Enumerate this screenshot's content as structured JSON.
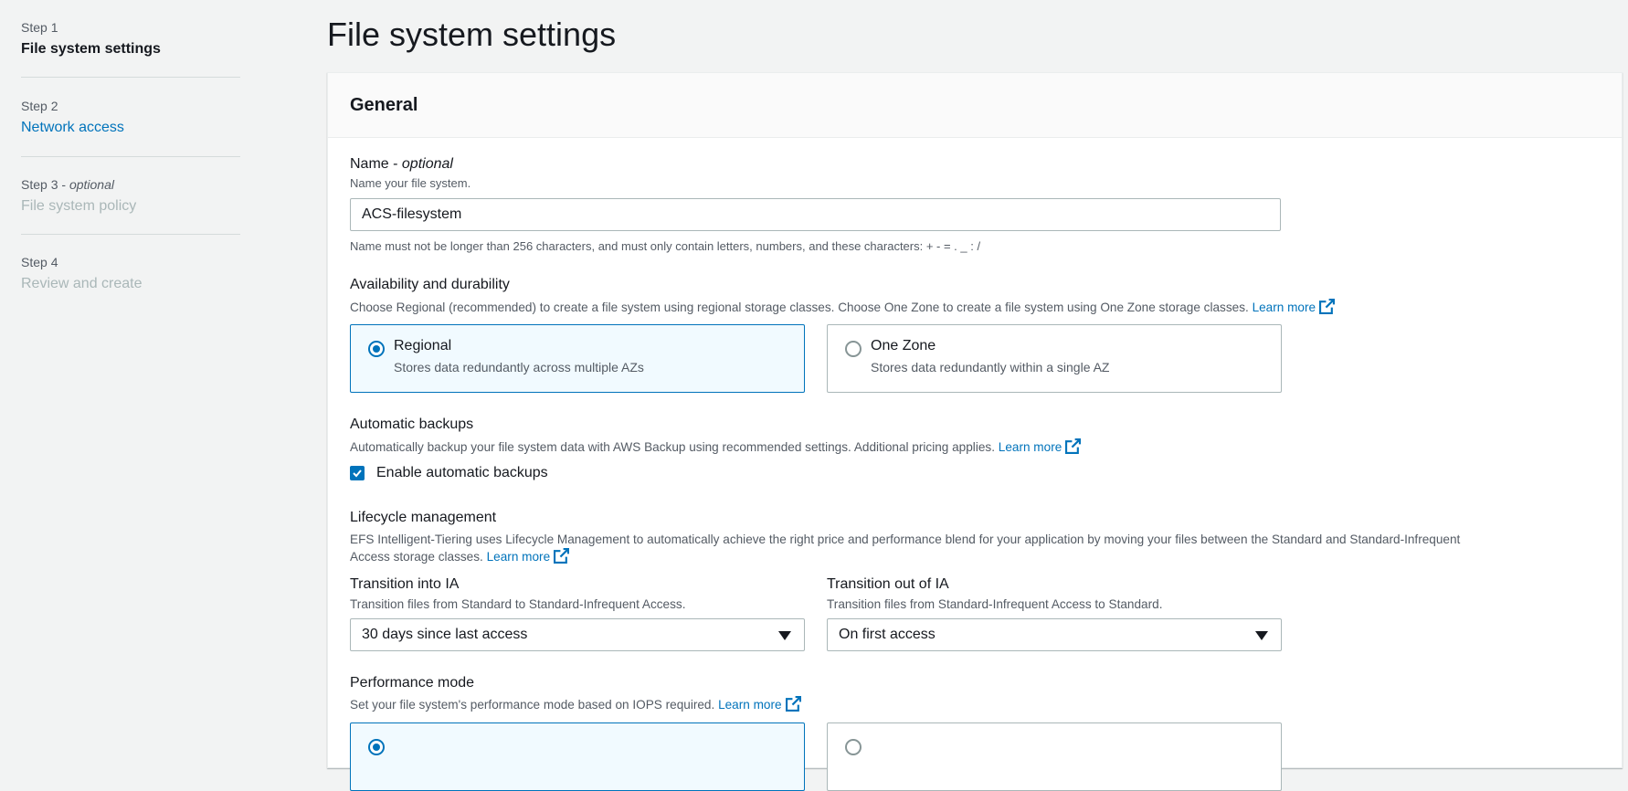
{
  "sidebar": {
    "steps": [
      {
        "num": "Step 1",
        "title": "File system settings"
      },
      {
        "num": "Step 2",
        "title": "Network access"
      },
      {
        "num": "Step 3",
        "num_suffix": "optional",
        "title": "File system policy"
      },
      {
        "num": "Step 4",
        "title": "Review and create"
      }
    ]
  },
  "page": {
    "title": "File system settings"
  },
  "general": {
    "header": "General",
    "name": {
      "label": "Name",
      "label_suffix": "optional",
      "description": "Name your file system.",
      "value": "ACS-filesystem",
      "constraint": "Name must not be longer than 256 characters, and must only contain letters, numbers, and these characters: + - = . _ : /"
    },
    "availability": {
      "label": "Availability and durability",
      "description": "Choose Regional (recommended) to create a file system using regional storage classes. Choose One Zone to create a file system using One Zone storage classes.",
      "learn_more": "Learn more",
      "options": [
        {
          "title": "Regional",
          "desc": "Stores data redundantly across multiple AZs",
          "selected": true
        },
        {
          "title": "One Zone",
          "desc": "Stores data redundantly within a single AZ",
          "selected": false
        }
      ]
    },
    "backups": {
      "label": "Automatic backups",
      "description": "Automatically backup your file system data with AWS Backup using recommended settings. Additional pricing applies.",
      "learn_more": "Learn more",
      "checkbox_label": "Enable automatic backups",
      "checked": true
    },
    "lifecycle": {
      "label": "Lifecycle management",
      "description_line1": "EFS Intelligent-Tiering uses Lifecycle Management to automatically achieve the right price and performance blend for your application by moving your files between the Standard and Standard-Infrequent",
      "description_line2": "Access storage classes.",
      "learn_more": "Learn more",
      "into_ia": {
        "label": "Transition into IA",
        "description": "Transition files from Standard to Standard-Infrequent Access.",
        "value": "30 days since last access"
      },
      "out_of_ia": {
        "label": "Transition out of IA",
        "description": "Transition files from Standard-Infrequent Access to Standard.",
        "value": "On first access"
      }
    },
    "performance": {
      "label": "Performance mode",
      "description": "Set your file system's performance mode based on IOPS required.",
      "learn_more": "Learn more"
    }
  },
  "colors": {
    "accent": "#0073bb",
    "background": "#f2f3f3"
  }
}
